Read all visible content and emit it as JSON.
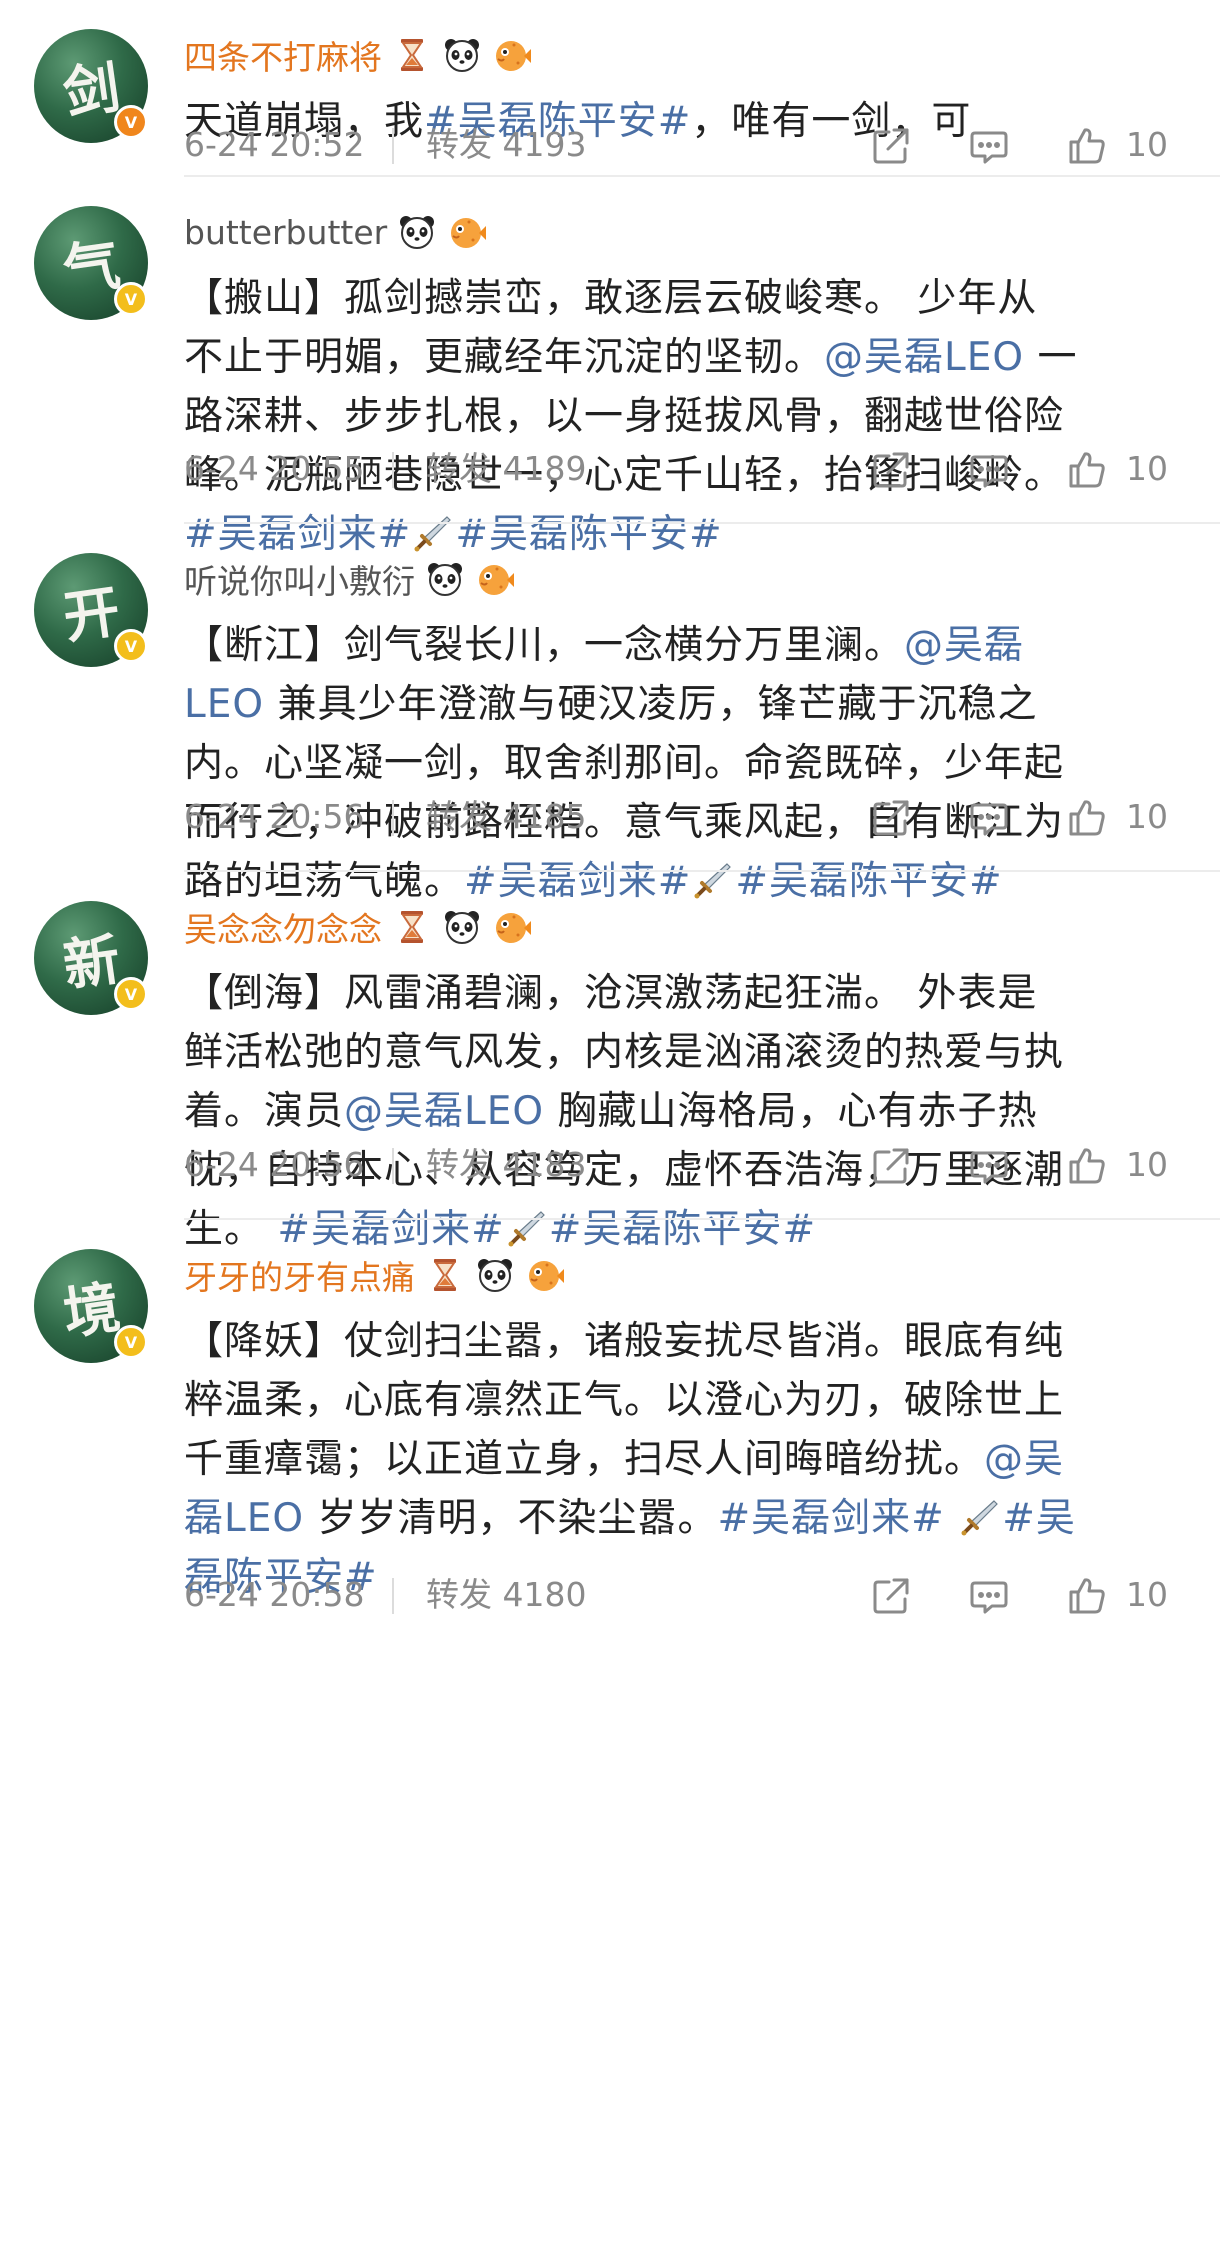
{
  "colors": {
    "accent_link": "#4a6fa5",
    "vip_name": "#e3761f",
    "meta": "#8a8a8a"
  },
  "icons": {
    "share": "share-icon",
    "comment": "comment-icon",
    "like": "thumbs-up-icon",
    "sword": "sword-icon",
    "panda": "panda-icon",
    "fish": "pufferfish-icon",
    "hourglass": "hourglass-icon"
  },
  "posts": [
    {
      "avatar_char": "剑",
      "badge": "V",
      "username": "四条不打麻将",
      "content": [
        {
          "t": "天道崩塌，我"
        },
        {
          "t": "#吴磊陈平安#",
          "link": true
        },
        {
          "t": "，唯有一剑，可"
        }
      ],
      "time": "6-24 20:52",
      "repost": "转发 4193",
      "likes": "10"
    },
    {
      "avatar_char": "气",
      "badge": "V",
      "username": "butterbutter",
      "content": [
        {
          "t": "【搬山】孤剑撼崇峦，敢逐层云破峻寒。 少年从\n不止于明媚，更藏经年沉淀的坚韧。"
        },
        {
          "t": "@吴磊LEO",
          "link": true
        },
        {
          "t": " 一\n路深耕、步步扎根，以一身挺拔风骨，翻越世俗险\n峰。泥瓶陋巷隐世一，心定千山轻，抬锋扫峻岭。\n"
        },
        {
          "t": "#吴磊剑来#",
          "link": true
        },
        {
          "sword": true
        },
        {
          "t": "#吴磊陈平安#",
          "link": true
        }
      ],
      "time": "6-24 20:55",
      "repost": "转发 4189",
      "likes": "10"
    },
    {
      "avatar_char": "开",
      "badge": "V",
      "username": "听说你叫小敷衍",
      "content": [
        {
          "t": "【断江】剑气裂长川，一念横分万里澜。"
        },
        {
          "t": "@吴磊\nLEO",
          "link": true
        },
        {
          "t": " 兼具少年澄澈与硬汉凌厉，锋芒藏于沉稳之\n内。心坚凝一剑，取舍刹那间。命瓷既碎，少年起\n而行之，冲破前路桎梏。意气乘风起，自有断江为\n路的坦荡气魄。"
        },
        {
          "t": "#吴磊剑来#",
          "link": true
        },
        {
          "sword": true
        },
        {
          "t": "#吴磊陈平安#",
          "link": true
        }
      ],
      "time": "6-24 20:56",
      "repost": "转发 4185",
      "likes": "10"
    },
    {
      "avatar_char": "新",
      "badge": "V",
      "username": "吴念念勿念念",
      "content": [
        {
          "t": "【倒海】风雷涌碧澜，沧溟激荡起狂湍。 外表是\n鲜活松弛的意气风发，内核是汹涌滚烫的热爱与执\n着。演员"
        },
        {
          "t": "@吴磊LEO",
          "link": true
        },
        {
          "t": " 胸藏山海格局，心有赤子热\n忱，自持本心、从容笃定，虚怀吞浩海，万里逐潮\n生。 "
        },
        {
          "t": "#吴磊剑来#",
          "link": true
        },
        {
          "sword": true
        },
        {
          "t": "#吴磊陈平安#",
          "link": true
        }
      ],
      "time": "6-24 20:56",
      "repost": "转发 4183",
      "likes": "10"
    },
    {
      "avatar_char": "境",
      "badge": "V",
      "username": "牙牙的牙有点痛",
      "content": [
        {
          "t": "【降妖】仗剑扫尘嚣，诸般妄扰尽皆消。眼底有纯\n粹温柔，心底有凛然正气。以澄心为刃，破除世上\n千重瘴霭；以正道立身，扫尽人间晦暗纷扰。"
        },
        {
          "t": "@吴\n磊LEO",
          "link": true
        },
        {
          "t": " 岁岁清明，不染尘嚣。"
        },
        {
          "t": "#吴磊剑来#",
          "link": true
        },
        {
          "t": " "
        },
        {
          "sword": true
        },
        {
          "t": "#吴\n磊陈平安#",
          "link": true
        }
      ],
      "time": "6-24 20:58",
      "repost": "转发 4180",
      "likes": "10"
    }
  ]
}
